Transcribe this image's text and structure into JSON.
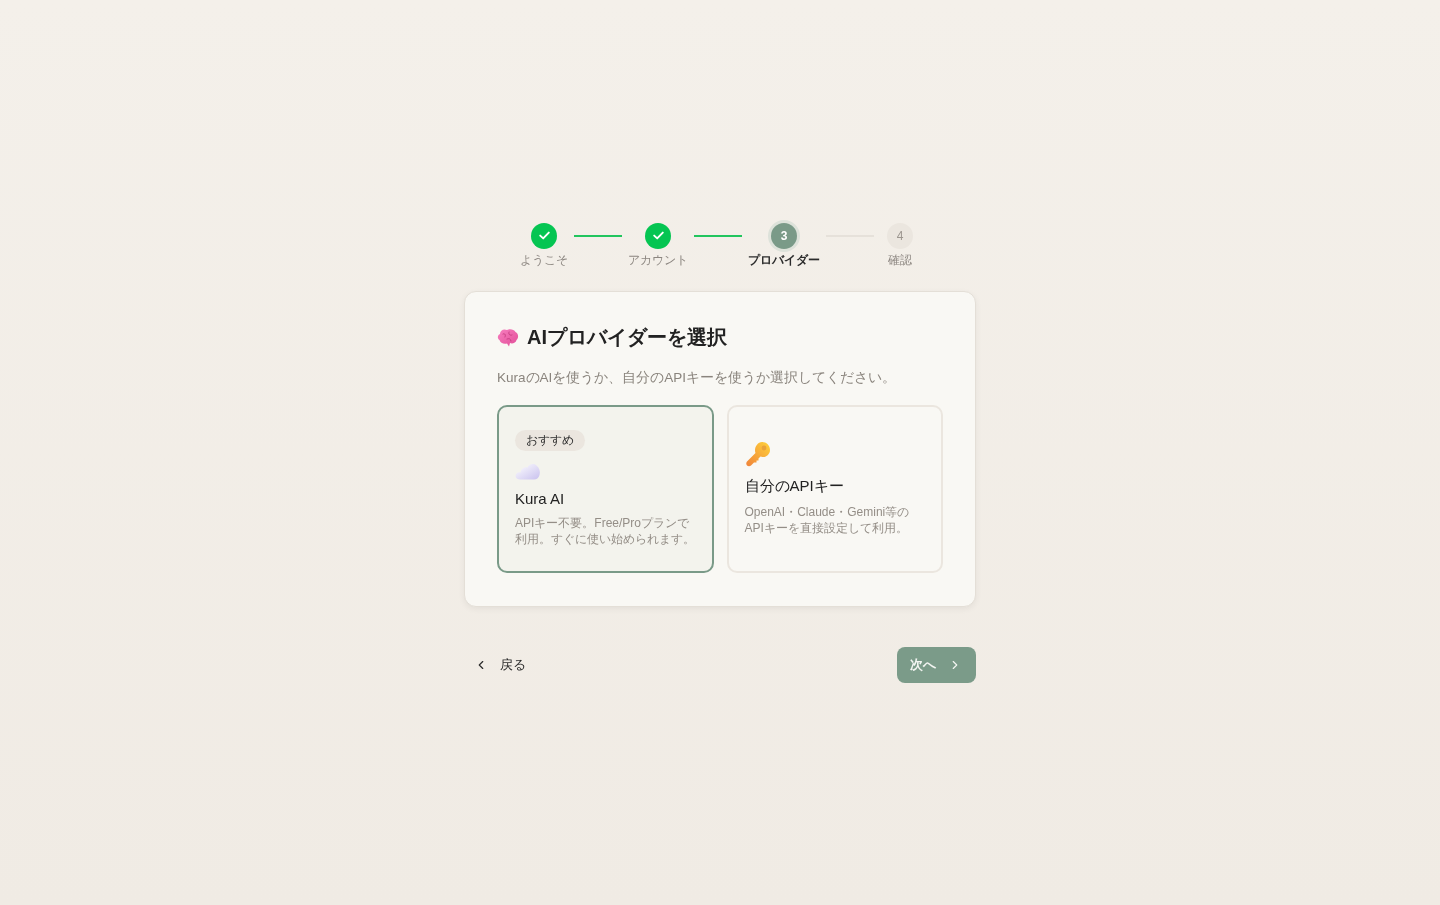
{
  "stepper": {
    "steps": [
      {
        "label": "ようこそ",
        "completed": true,
        "selected": false
      },
      {
        "label": "アカウント",
        "completed": true,
        "selected": false
      },
      {
        "number": "3",
        "label": "プロバイダー",
        "completed": false,
        "selected": true
      },
      {
        "number": "4",
        "label": "確認",
        "completed": false,
        "selected": false
      }
    ]
  },
  "panel": {
    "title": "AIプロバイダーを選択",
    "subtitle": "KuraのAIを使うか、自分のAPIキーを使うか選択してください。",
    "options": [
      {
        "badge": "おすすめ",
        "title": "Kura AI",
        "description": "APIキー不要。Free/Proプランで利用。すぐに使い始められます。",
        "selected": true
      },
      {
        "title": "自分のAPIキー",
        "description": "OpenAI・Claude・Gemini等のAPIキーを直接設定して利用。",
        "selected": false
      }
    ]
  },
  "actions": {
    "back": "戻る",
    "next": "次へ"
  }
}
